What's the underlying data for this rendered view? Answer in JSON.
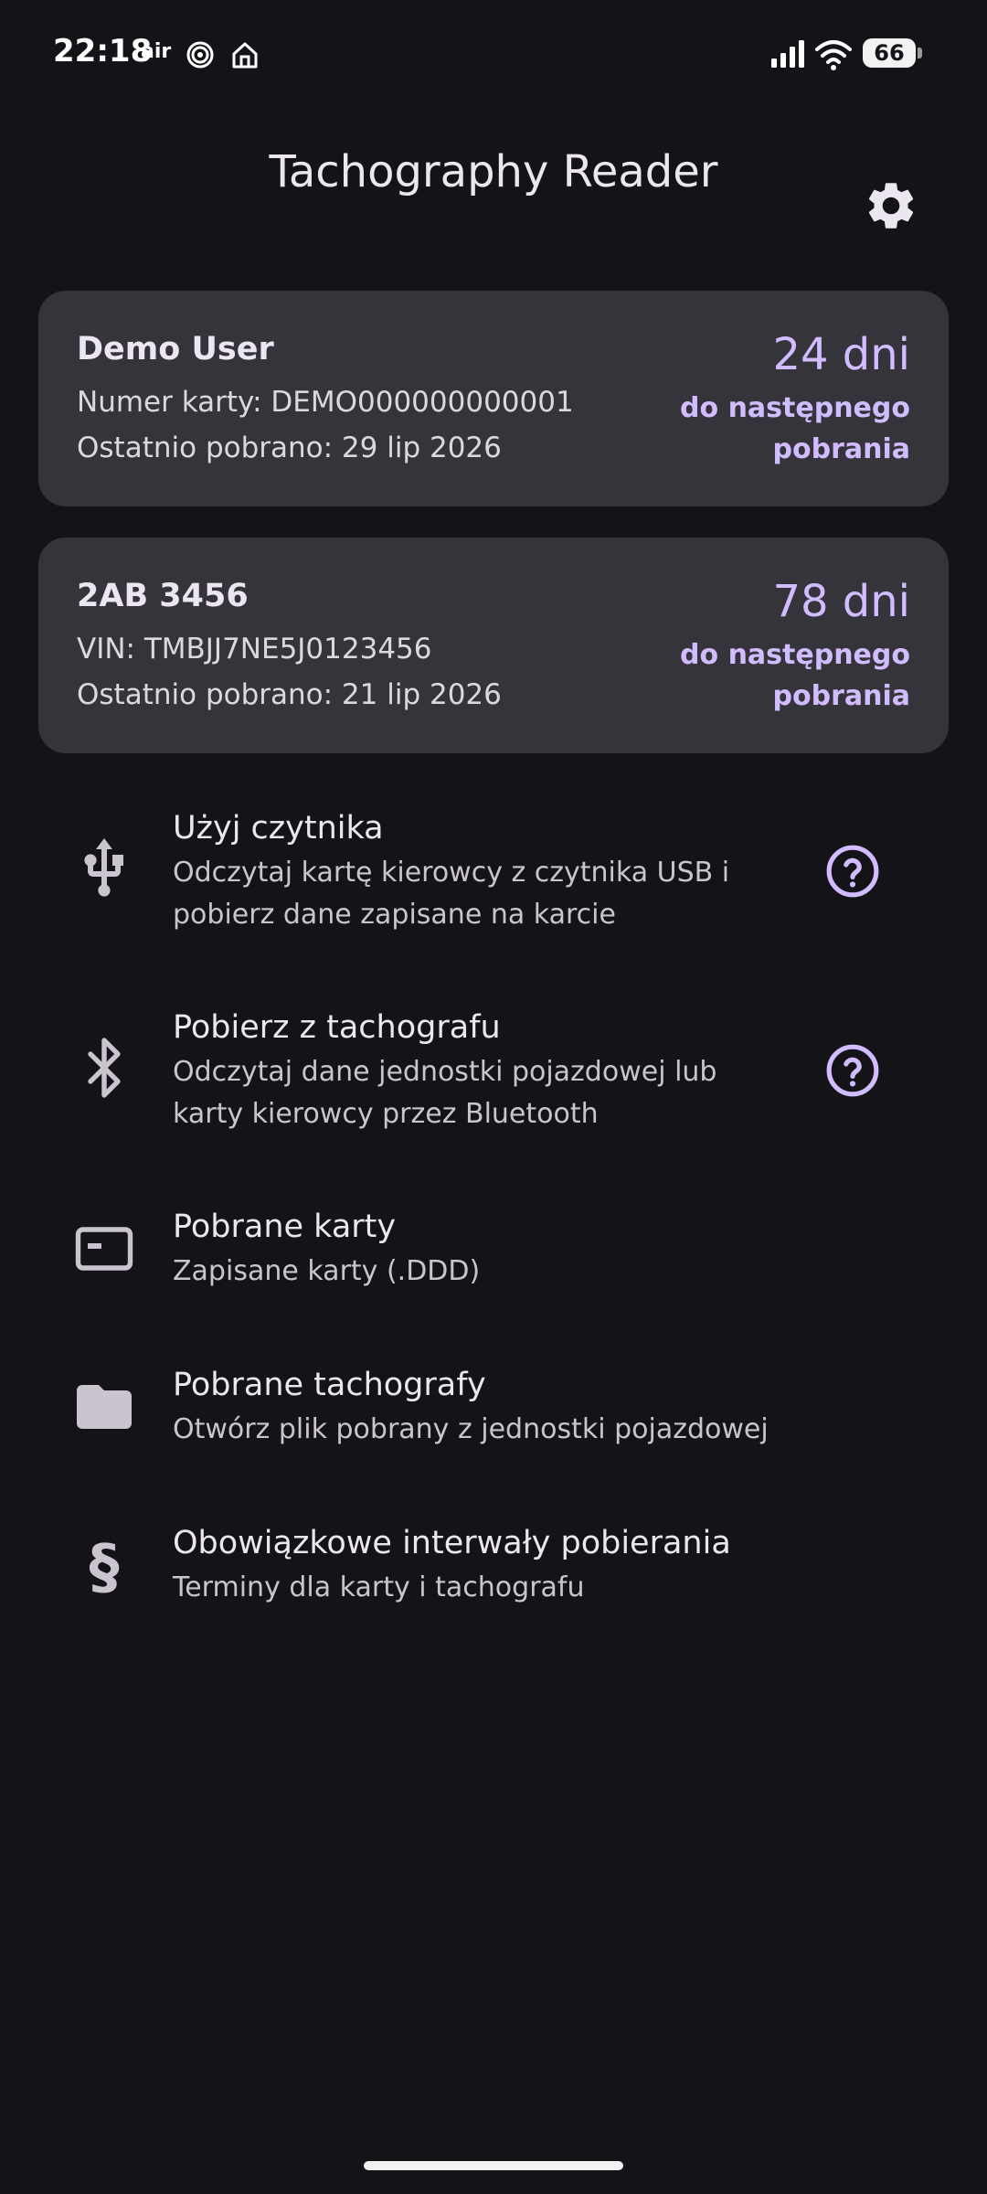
{
  "status_bar": {
    "time": "22:18",
    "air_label": "air",
    "battery": "66"
  },
  "header": {
    "title": "Tachography Reader"
  },
  "cards": [
    {
      "title": "Demo User",
      "line1": "Numer karty: DEMO000000000001",
      "line2": "Ostatnio pobrano: 29 lip 2026",
      "days": "24 dni",
      "days_sub": "do następnego pobrania"
    },
    {
      "title": "2AB 3456",
      "line1": "VIN: TMBJJ7NE5J0123456",
      "line2": "Ostatnio pobrano: 21 lip 2026",
      "days": "78 dni",
      "days_sub": "do następnego pobrania"
    }
  ],
  "menu": [
    {
      "title": "Użyj czytnika",
      "subtitle": "Odczytaj kartę kierowcy z czytnika USB i pobierz dane zapisane na karcie",
      "icon": "usb-icon",
      "help": true
    },
    {
      "title": "Pobierz z tachografu",
      "subtitle": "Odczytaj dane jednostki pojazdowej lub karty kierowcy przez Bluetooth",
      "icon": "bluetooth-icon",
      "help": true
    },
    {
      "title": "Pobrane karty",
      "subtitle": "Zapisane karty (.DDD)",
      "icon": "card-icon",
      "help": false
    },
    {
      "title": "Pobrane tachografy",
      "subtitle": "Otwórz plik pobrany z jednostki pojazdowej",
      "icon": "folder-icon",
      "help": false
    },
    {
      "title": "Obowiązkowe interwały pobierania",
      "subtitle": "Terminy dla karty i tachografu",
      "icon": "section-icon",
      "help": false
    }
  ],
  "colors": {
    "background": "#141318",
    "card": "#36343b",
    "accent": "#d0bcff",
    "text": "#ece6f0"
  }
}
